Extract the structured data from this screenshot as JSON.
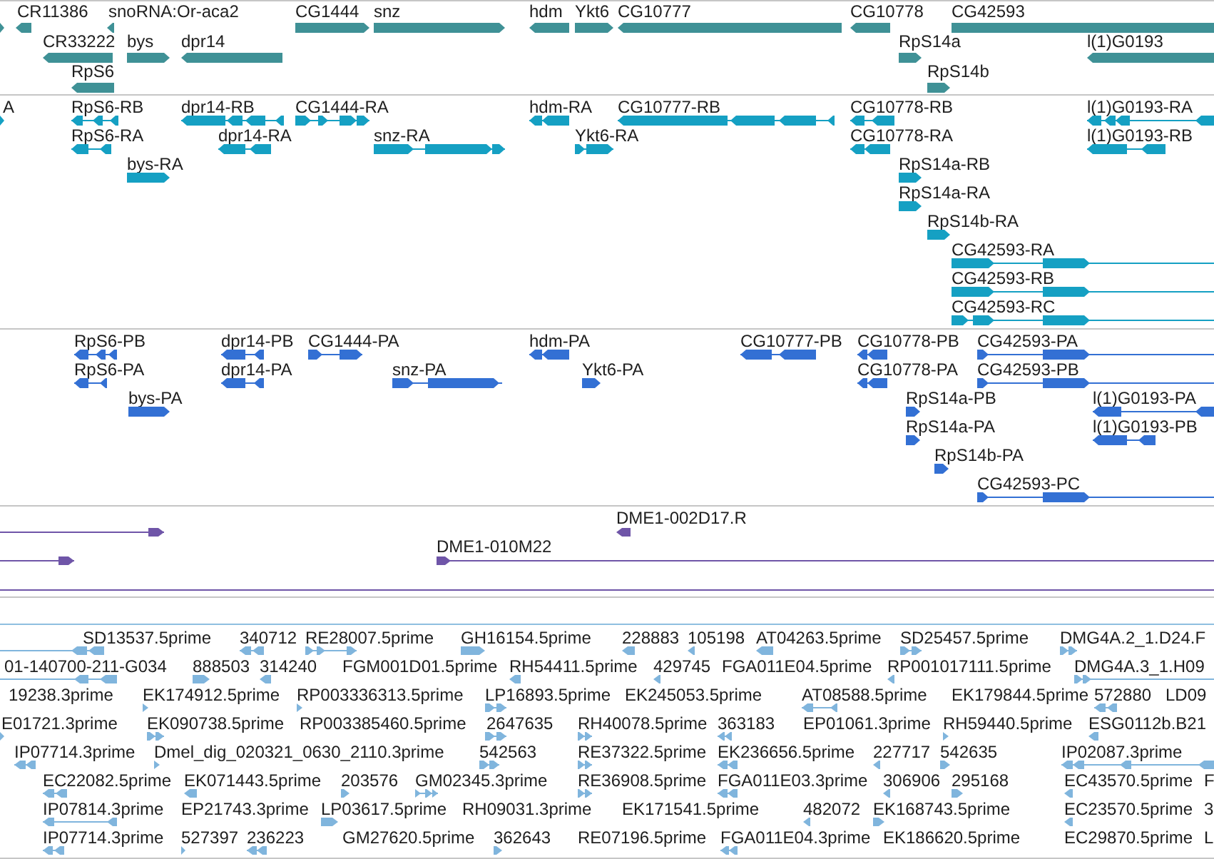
{
  "tracks": [
    {
      "kind": "gene",
      "features": [
        {
          "reverse": false
        },
        {
          "label": "CR11386",
          "reverse": true
        },
        {
          "label": "snoRNA:Or-aca2",
          "reverse": true
        },
        {
          "label": "CG1444",
          "reverse": false
        },
        {
          "label": "snz",
          "reverse": false
        },
        {
          "label": "hdm",
          "reverse": true
        },
        {
          "label": "Ykt6",
          "reverse": false
        },
        {
          "label": "CG10777",
          "reverse": true
        },
        {
          "label": "CG10778",
          "reverse": true
        },
        {
          "label": "CG42593",
          "reverse": false
        },
        {
          "label": "CR33222",
          "reverse": true
        },
        {
          "label": "bys",
          "reverse": false
        },
        {
          "label": "dpr14",
          "reverse": true
        },
        {
          "label": "RpS14a",
          "reverse": false
        },
        {
          "label": "l(1)G0193",
          "reverse": true
        },
        {
          "label": "RpS6",
          "reverse": true
        },
        {
          "label": "RpS14b",
          "reverse": false
        }
      ]
    },
    {
      "kind": "transcript",
      "features": [
        {
          "label": "A",
          "reverse": false
        },
        {
          "label": "RpS6-RB",
          "reverse": true
        },
        {
          "label": "dpr14-RB",
          "reverse": true
        },
        {
          "label": "CG1444-RA",
          "reverse": false
        },
        {
          "label": "hdm-RA",
          "reverse": true
        },
        {
          "label": "CG10777-RB",
          "reverse": true
        },
        {
          "label": "CG10778-RB",
          "reverse": true
        },
        {
          "label": "l(1)G0193-RA",
          "reverse": true
        },
        {
          "label": "RpS6-RA",
          "reverse": true
        },
        {
          "label": "dpr14-RA",
          "reverse": true
        },
        {
          "label": "snz-RA",
          "reverse": false
        },
        {
          "label": "Ykt6-RA",
          "reverse": false
        },
        {
          "label": "CG10778-RA",
          "reverse": true
        },
        {
          "label": "l(1)G0193-RB",
          "reverse": true
        },
        {
          "label": "bys-RA",
          "reverse": false
        },
        {
          "label": "RpS14a-RB",
          "reverse": false
        },
        {
          "label": "RpS14a-RA",
          "reverse": false
        },
        {
          "label": "RpS14b-RA",
          "reverse": false
        },
        {
          "label": "CG42593-RA",
          "reverse": false
        },
        {
          "label": "CG42593-RB",
          "reverse": false
        },
        {
          "label": "CG42593-RC",
          "reverse": false
        }
      ]
    },
    {
      "kind": "protein",
      "features": [
        {
          "label": "RpS6-PB",
          "reverse": true
        },
        {
          "label": "dpr14-PB",
          "reverse": true
        },
        {
          "label": "CG1444-PA",
          "reverse": false
        },
        {
          "label": "hdm-PA",
          "reverse": true
        },
        {
          "label": "CG10777-PB",
          "reverse": true
        },
        {
          "label": "CG10778-PB",
          "reverse": true
        },
        {
          "label": "CG42593-PA",
          "reverse": false
        },
        {
          "label": "RpS6-PA",
          "reverse": true
        },
        {
          "label": "dpr14-PA",
          "reverse": true
        },
        {
          "label": "snz-PA",
          "reverse": false
        },
        {
          "label": "Ykt6-PA",
          "reverse": false
        },
        {
          "label": "CG10778-PA",
          "reverse": true
        },
        {
          "label": "CG42593-PB",
          "reverse": false
        },
        {
          "label": "bys-PA",
          "reverse": false
        },
        {
          "label": "RpS14a-PB",
          "reverse": false
        },
        {
          "label": "l(1)G0193-PA",
          "reverse": true
        },
        {
          "label": "RpS14a-PA",
          "reverse": false
        },
        {
          "label": "l(1)G0193-PB",
          "reverse": true
        },
        {
          "label": "RpS14b-PA",
          "reverse": false
        },
        {
          "label": "CG42593-PC",
          "reverse": false
        }
      ]
    },
    {
      "kind": "clone",
      "features": [
        {
          "reverse": false
        },
        {
          "label": "DME1-002D17.R",
          "reverse": true
        },
        {
          "reverse": false
        },
        {
          "label": "DME1-010M22",
          "reverse": false
        }
      ]
    },
    {
      "kind": "est",
      "features": [
        {
          "reverse": true
        },
        {
          "label": "SD13537.5prime"
        },
        {
          "label": "340712",
          "reverse": true
        },
        {
          "label": "RE28007.5prime",
          "reverse": false
        },
        {
          "label": "GH16154.5prime",
          "reverse": false
        },
        {
          "label": "228883",
          "reverse": true
        },
        {
          "label": "105198",
          "reverse": true
        },
        {
          "label": "AT04263.5prime",
          "reverse": true
        },
        {
          "label": "SD25457.5prime",
          "reverse": false
        },
        {
          "label": "DMG4A.2_1.D24.F",
          "reverse": false
        },
        {
          "label": "01-140700-211-G034",
          "reverse": true
        },
        {
          "label": "888503",
          "reverse": false
        },
        {
          "label": "314240",
          "reverse": true
        },
        {
          "label": "FGM001D01.5prime"
        },
        {
          "label": "RH54411.5prime",
          "reverse": true
        },
        {
          "label": "429745",
          "reverse": true
        },
        {
          "label": "FGA011E04.5prime"
        },
        {
          "label": "RP001017111.5prime",
          "reverse": true
        },
        {
          "label": "DMG4A.3_1.H09",
          "reverse": false
        },
        {
          "label": "19238.3prime"
        },
        {
          "label": "EK174912.5prime",
          "reverse": false
        },
        {
          "label": "RP003336313.5prime",
          "reverse": false
        },
        {
          "label": "LP16893.5prime",
          "reverse": false
        },
        {
          "label": "EK245053.5prime"
        },
        {
          "label": "AT08588.5prime",
          "reverse": true
        },
        {
          "label": "EK179844.5prime"
        },
        {
          "label": "572880",
          "reverse": true
        },
        {
          "label": "LD09"
        },
        {
          "label": "E01721.3prime",
          "reverse": false
        },
        {
          "label": "EK090738.5prime",
          "reverse": false
        },
        {
          "label": "RP003385460.5prime"
        },
        {
          "label": "2647635",
          "reverse": false
        },
        {
          "label": "RH40078.5prime",
          "reverse": false
        },
        {
          "label": "363183",
          "reverse": true
        },
        {
          "label": "EP01061.3prime"
        },
        {
          "label": "RH59440.5prime",
          "reverse": false
        },
        {
          "label": "ESG0112b.B21",
          "reverse": true
        },
        {
          "label": "IP07714.3prime",
          "reverse": true
        },
        {
          "label": "Dmel_dig_020321_0630_2110.3prime",
          "reverse": false
        },
        {
          "label": "542563",
          "reverse": false
        },
        {
          "label": "RE37322.5prime",
          "reverse": false
        },
        {
          "label": "EK236656.5prime",
          "reverse": true
        },
        {
          "label": "227717",
          "reverse": true
        },
        {
          "label": "542635",
          "reverse": false
        },
        {
          "label": "IP02087.3prime",
          "reverse": true
        },
        {
          "label": "EC22082.5prime",
          "reverse": true
        },
        {
          "label": "EK071443.5prime",
          "reverse": true
        },
        {
          "label": "203576",
          "reverse": false
        },
        {
          "label": "GM02345.3prime",
          "reverse": false
        },
        {
          "label": "RE36908.5prime",
          "reverse": false
        },
        {
          "label": "FGA011E03.3prime",
          "reverse": true
        },
        {
          "label": "306906",
          "reverse": true
        },
        {
          "label": "295168",
          "reverse": false
        },
        {
          "label": "EC43570.5prime",
          "reverse": true
        },
        {
          "label": "F"
        },
        {
          "label": "IP07814.3prime",
          "reverse": true
        },
        {
          "label": "EP21743.3prime"
        },
        {
          "label": "LP03617.5prime",
          "reverse": false
        },
        {
          "label": "RH09031.3prime"
        },
        {
          "label": "EK171541.5prime"
        },
        {
          "label": "482072",
          "reverse": true
        },
        {
          "label": "EK168743.5prime",
          "reverse": false
        },
        {
          "label": "EC23570.5prime",
          "reverse": true
        },
        {
          "label": "3"
        },
        {
          "label": "IP07714.3prime",
          "reverse": true
        },
        {
          "label": "527397",
          "reverse": false
        },
        {
          "label": "236223",
          "reverse": true
        },
        {
          "label": "GM27620.5prime"
        },
        {
          "label": "362643",
          "reverse": false
        },
        {
          "label": "RE07196.5prime"
        },
        {
          "label": "FGA011E04.3prime",
          "reverse": true
        },
        {
          "label": "EK186620.5prime"
        },
        {
          "label": "EC29870.5prime"
        },
        {
          "label": "L"
        }
      ]
    }
  ]
}
